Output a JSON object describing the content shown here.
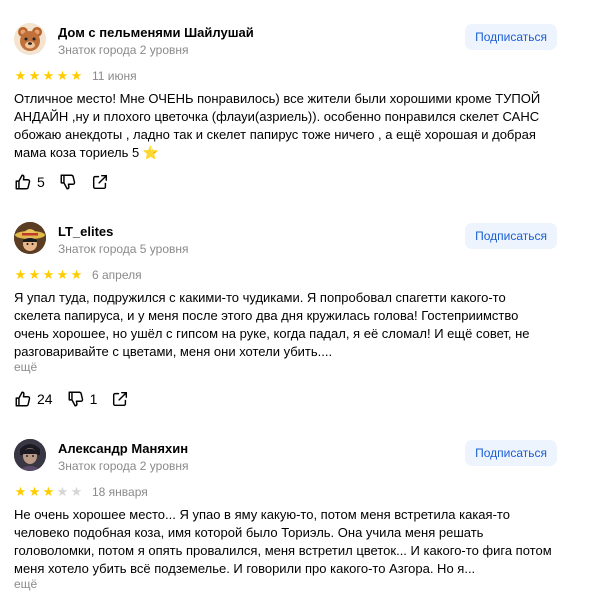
{
  "colors": {
    "accent": "#1a5fd0",
    "star_filled": "#ffcc00",
    "star_empty": "#d6d6d6",
    "muted": "#8a8a8a",
    "button_bg": "#eef4fe"
  },
  "reviews": [
    {
      "author": "Дом с пельменями Шайлушай",
      "meta": "Знаток города 2 уровня",
      "subscribe_label": "Подписаться",
      "rating": 5,
      "date": "11 июня",
      "text": "Отличное место! Мне ОЧЕНЬ понравилось) все жители были хорошими кроме ТУПОЙ АНДАЙН ,ну и плохого цветочка (флауи(азриель)). особенно понравился скелет САНС обожаю анекдоты , ладно так и скелет папирус тоже ничего , а ещё хорошая и добрая мама коза ториель 5",
      "text_emoji": "⭐",
      "likes": "5",
      "dislikes": "",
      "more_label": "",
      "avatar_icon": "bear-face-icon"
    },
    {
      "author": "LT_elites",
      "meta": "Знаток города 5 уровня",
      "subscribe_label": "Подписаться",
      "rating": 5,
      "date": "6 апреля",
      "text": "Я упал туда, подружился с какими-то чудиками. Я попробовал спагетти какого-то скелета папируса, и у меня после этого два дня кружилась голова! Гостеприимство очень хорошее, но ушёл с гипсом на руке, когда падал, я её сломал! И ещё совет, не разговаривайте с цветами, меня они хотели убить....",
      "text_emoji": "",
      "likes": "24",
      "dislikes": "1",
      "more_label": "ещё",
      "avatar_icon": "straw-hat-avatar-icon"
    },
    {
      "author": "Александр Маняхин",
      "meta": "Знаток города 2 уровня",
      "subscribe_label": "Подписаться",
      "rating": 3,
      "date": "18 января",
      "text": "Не очень хорошее место... Я упао в яму какую-то, потом меня встретила какая-то человеко подобная коза, имя которой было Ториэль. Она учила меня решать головоломки, потом я опять провалился, меня встретил цветок... И какого-то фига потом меня хотело убить всё подземелье. И говорили про какого-то Азгора. Но я...",
      "text_emoji": "",
      "likes": "",
      "dislikes": "",
      "more_label": "ещё",
      "avatar_icon": "portrait-avatar-icon"
    }
  ]
}
